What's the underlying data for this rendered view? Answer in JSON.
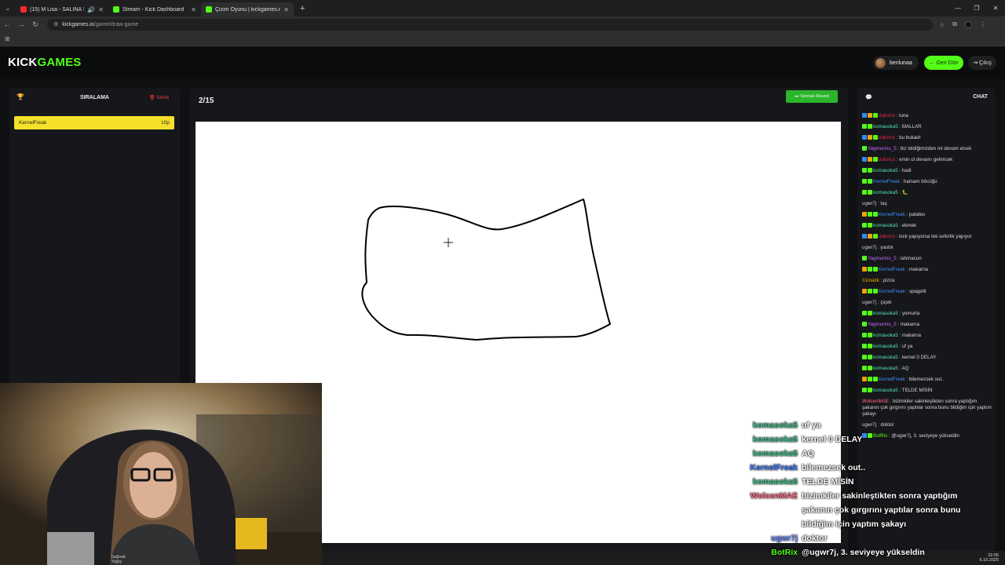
{
  "browser": {
    "tabs": [
      {
        "title": "(15) M Lisa - SALINA SALIN",
        "favicon_color": "#ff2a2a",
        "active": false
      },
      {
        "title": "Stream - Kick Dashboard",
        "favicon_color": "#53fc18",
        "active": false
      },
      {
        "title": "Çizim Oyunu | kickgames.io",
        "favicon_color": "#53fc18",
        "active": true
      }
    ],
    "url_host": "kickgames.io",
    "url_path": "/game/draw-game"
  },
  "header": {
    "logo_part1": "KICK",
    "logo_part2": "GAMES",
    "username": "benlunaa",
    "back_label": "Geri Dön",
    "exit_label": "Çıkış"
  },
  "leaderboard": {
    "title": "SIRALAMA",
    "reset_label": "Sıfırla",
    "rows": [
      {
        "name": "KernelFreak",
        "score": "10p"
      }
    ]
  },
  "game": {
    "round": "2/15",
    "next_round_label": "Sonraki Round"
  },
  "chat": {
    "title": "CHAT",
    "messages": [
      {
        "user": "dabvicx",
        "color": "#e0254a",
        "badges": [
          "#2f8cff",
          "#f0a500",
          "#53fc18"
        ],
        "text": "luna"
      },
      {
        "user": "komasoka5",
        "color": "#53e3b0",
        "badges": [
          "#53fc18",
          "#53fc18"
        ],
        "text": "MALLAR"
      },
      {
        "user": "dabvicx",
        "color": "#e0254a",
        "badges": [
          "#2f8cff",
          "#f0a500",
          "#53fc18"
        ],
        "text": "bu bukadr"
      },
      {
        "user": "Yagmurmu_5",
        "color": "#c66cff",
        "badges": [
          "#53fc18"
        ],
        "text": "biz bildiğimizden mi devam etsek"
      },
      {
        "user": "dabvicx",
        "color": "#e0254a",
        "badges": [
          "#2f8cff",
          "#f0a500",
          "#53fc18"
        ],
        "text": "emin ol devamı gelmicek"
      },
      {
        "user": "komasoka5",
        "color": "#53e3b0",
        "badges": [
          "#53fc18",
          "#53fc18"
        ],
        "text": "hadi"
      },
      {
        "user": "KernelFreak",
        "color": "#3d8fff",
        "badges": [
          "#53fc18",
          "#53fc18"
        ],
        "text": "hamam böcüğü"
      },
      {
        "user": "komasoka5",
        "color": "#53e3b0",
        "badges": [
          "#53fc18",
          "#53fc18"
        ],
        "text": "🐛"
      },
      {
        "user": "ugwr7j",
        "color": "#cfcfcf",
        "badges": [],
        "text": "taş"
      },
      {
        "user": "KernelFreak",
        "color": "#3d8fff",
        "badges": [
          "#f0a500",
          "#53fc18",
          "#53fc18"
        ],
        "text": "patates"
      },
      {
        "user": "komasoka5",
        "color": "#53e3b0",
        "badges": [
          "#53fc18",
          "#53fc18"
        ],
        "text": "ekmek"
      },
      {
        "user": "dabvicx",
        "color": "#e0254a",
        "badges": [
          "#2f8cff",
          "#f0a500",
          "#53fc18"
        ],
        "text": "kick yapıyorsa tek seferlik yapıyor"
      },
      {
        "user": "ugwr7j",
        "color": "#cfcfcf",
        "badges": [],
        "text": "yastık"
      },
      {
        "user": "Yagmurmu_5",
        "color": "#c66cff",
        "badges": [
          "#53fc18"
        ],
        "text": "lahmacun"
      },
      {
        "user": "KernelFreak",
        "color": "#3d8fff",
        "badges": [
          "#f0a500",
          "#53fc18",
          "#53fc18"
        ],
        "text": "makarna"
      },
      {
        "user": "31matik",
        "color": "#f0a500",
        "badges": [],
        "text": "pizza"
      },
      {
        "user": "KernelFreak",
        "color": "#3d8fff",
        "badges": [
          "#f0a500",
          "#53fc18",
          "#53fc18"
        ],
        "text": "spagetti"
      },
      {
        "user": "ugwr7j",
        "color": "#cfcfcf",
        "badges": [],
        "text": "çiçek"
      },
      {
        "user": "komasoka5",
        "color": "#53e3b0",
        "badges": [
          "#53fc18",
          "#53fc18"
        ],
        "text": "yumurta"
      },
      {
        "user": "Yagmurmu_5",
        "color": "#c66cff",
        "badges": [
          "#53fc18"
        ],
        "text": "makarna"
      },
      {
        "user": "komasoka5",
        "color": "#53e3b0",
        "badges": [
          "#53fc18",
          "#53fc18"
        ],
        "text": "makarna"
      },
      {
        "user": "komasoka5",
        "color": "#53e3b0",
        "badges": [
          "#53fc18",
          "#53fc18"
        ],
        "text": "uf ya"
      },
      {
        "user": "komasoka5",
        "color": "#53e3b0",
        "badges": [
          "#53fc18",
          "#53fc18"
        ],
        "text": "kernel 0 DELAY"
      },
      {
        "user": "komasoka5",
        "color": "#53e3b0",
        "badges": [
          "#53fc18",
          "#53fc18"
        ],
        "text": "AQ"
      },
      {
        "user": "KernelFreak",
        "color": "#3d8fff",
        "badges": [
          "#f0a500",
          "#53fc18",
          "#53fc18"
        ],
        "text": "bilemezsek out.."
      },
      {
        "user": "komasoka5",
        "color": "#53e3b0",
        "badges": [
          "#53fc18",
          "#53fc18"
        ],
        "text": "TELDE MİSİN"
      },
      {
        "user": "WolcenMAE",
        "color": "#ff6b8a",
        "badges": [],
        "text": "bizimkiler sakinleştikten sonra yaptığım şakanın çok gırgırını yaptılar sonra bunu bildiğim için yaptım şakayı"
      },
      {
        "user": "ugwr7j",
        "color": "#cfcfcf",
        "badges": [],
        "text": "doktor"
      },
      {
        "user": "BotRix",
        "color": "#53fc18",
        "badges": [
          "#2f8cff",
          "#53fc18"
        ],
        "text": "@ugwr7j, 3. seviyeye yükseldin"
      }
    ]
  },
  "overlay_chat": [
    {
      "user": "komasoka5",
      "color": "#3fbf8a",
      "text": "uf ya"
    },
    {
      "user": "komasoka5",
      "color": "#3fbf8a",
      "text": "kernel 0 DELAY"
    },
    {
      "user": "komasoka5",
      "color": "#3fbf8a",
      "text": "AQ"
    },
    {
      "user": "KernelFreak",
      "color": "#3d7bff",
      "text": "bilemezsek out.."
    },
    {
      "user": "komasoka5",
      "color": "#3fbf8a",
      "text": "TELDE MİSİN"
    },
    {
      "user": "WolcenMAE",
      "color": "#ff6b8a",
      "text": "bizimkiler sakinleştikten sonra yaptığım"
    },
    {
      "user": "",
      "color": "#ffffff",
      "text": "şakanın çok gırgırını yaptılar sonra bunu"
    },
    {
      "user": "",
      "color": "#ffffff",
      "text": "bildiğim için yaptım şakayı"
    },
    {
      "user": "ugwr7j",
      "color": "#6b8cff",
      "text": "doktor"
    },
    {
      "user": "BotRix",
      "color": "#53fc18",
      "text": "@ugwr7j, 3. seviyeye yükseldin"
    }
  ],
  "taskbar": {
    "time": "22:05",
    "date": "6.10.2025",
    "weather": "Sağnak Yağış"
  }
}
